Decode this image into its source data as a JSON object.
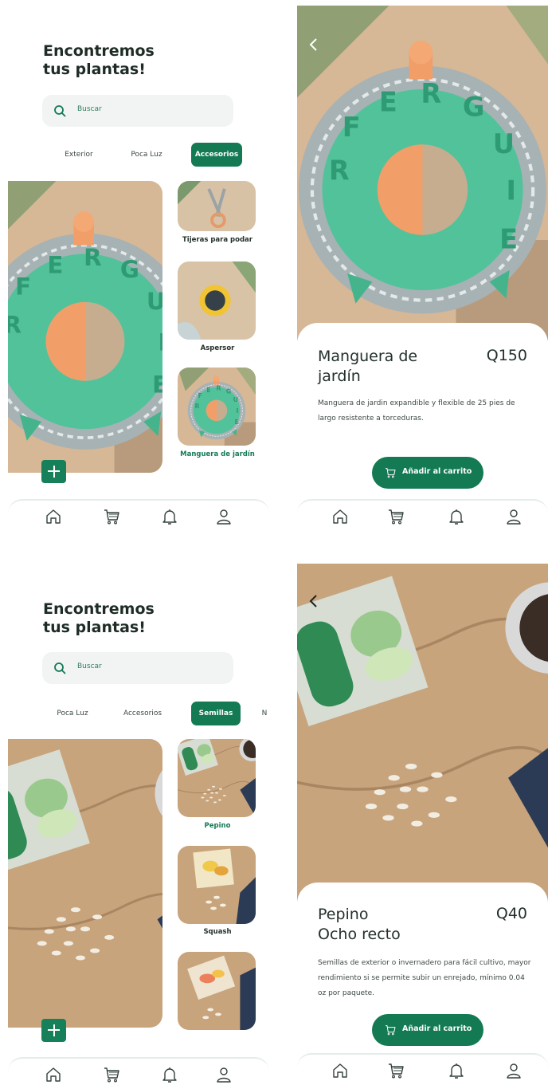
{
  "screen_list_accesorios": {
    "title_line1": "Encontremos",
    "title_line2": "tus plantas!",
    "search_placeholder": "Buscar",
    "categories": [
      {
        "label": "Exterior",
        "active": false
      },
      {
        "label": "Poca Luz",
        "active": false
      },
      {
        "label": "Accesorios",
        "active": true
      }
    ],
    "products": [
      {
        "label": "Tijeras para podar",
        "active": false
      },
      {
        "label": "Aspersor",
        "active": false
      },
      {
        "label": "Manguera de jardín",
        "active": true
      }
    ]
  },
  "screen_detail_manguera": {
    "name_line1": "Manguera de",
    "name_line2": "jardín",
    "price": "Q150",
    "description": "Manguera de jardin expandible y flexible de 25 pies de largo resistente a torceduras.",
    "add_to_cart": "Añadir al carrito"
  },
  "screen_list_semillas": {
    "title_line1": "Encontremos",
    "title_line2": "tus plantas!",
    "search_placeholder": "Buscar",
    "categories": [
      {
        "label": "Poca Luz",
        "active": false
      },
      {
        "label": "Accesorios",
        "active": false
      },
      {
        "label": "Semillas",
        "active": true
      },
      {
        "label": "N",
        "active": false
      }
    ],
    "products": [
      {
        "label": "Pepino",
        "active": true
      },
      {
        "label": "Squash",
        "active": false
      },
      {
        "label": "",
        "active": false
      }
    ]
  },
  "screen_detail_pepino": {
    "name_line1": "Pepino",
    "name_line2": "Ocho recto",
    "price": "Q40",
    "description": "Semillas de exterior o invernadero para fácil cultivo, mayor rendimiento si se permite subir un enrejado, mínimo 0.04 oz por paquete.",
    "add_to_cart": "Añadir al carrito"
  },
  "tabbar": {
    "icons": [
      "home-icon",
      "cart-icon",
      "bell-icon",
      "user-icon"
    ]
  },
  "colors": {
    "primary": "#137a54",
    "hose_green": "#54c39b",
    "orange": "#f3a16c",
    "wood": "#c9a57c",
    "text_dark": "#1e2c25"
  }
}
